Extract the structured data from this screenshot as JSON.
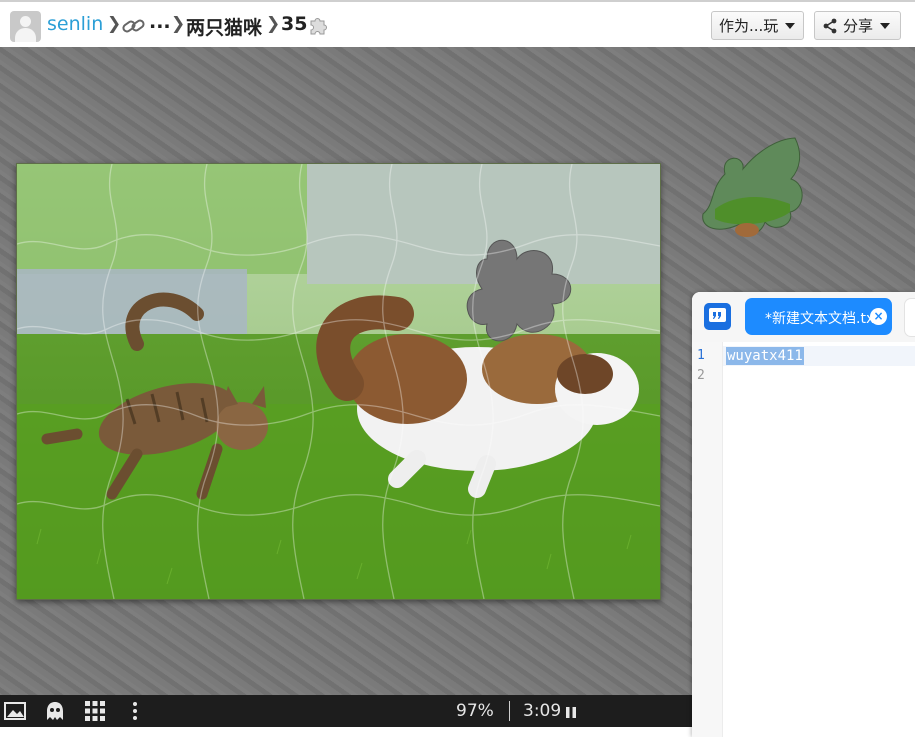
{
  "header": {
    "username": "senlin",
    "ellipsis": "...",
    "puzzle_title": "两只猫咪",
    "piece_count": "35",
    "play_as_label": "作为...玩",
    "share_label": "分享"
  },
  "game": {
    "progress": "97%",
    "timer": "3:09",
    "progress_fraction": 0.97
  },
  "editor": {
    "tab_title": "*新建文本文档.txt",
    "tab_close": "×",
    "line_numbers": [
      "1",
      "2"
    ],
    "line1_text": "wuyatx411"
  },
  "colors": {
    "link_blue": "#2b9fd6",
    "tab_blue": "#1d8bff",
    "selection_blue": "#8cb8ea",
    "toolbar_dark": "#1d1d1d"
  },
  "icons": [
    "avatar",
    "link-icon",
    "puzzle-piece-icon",
    "share-icon",
    "image-icon",
    "ghost-icon",
    "grid-icon",
    "more-vertical-icon",
    "pause-icon"
  ]
}
